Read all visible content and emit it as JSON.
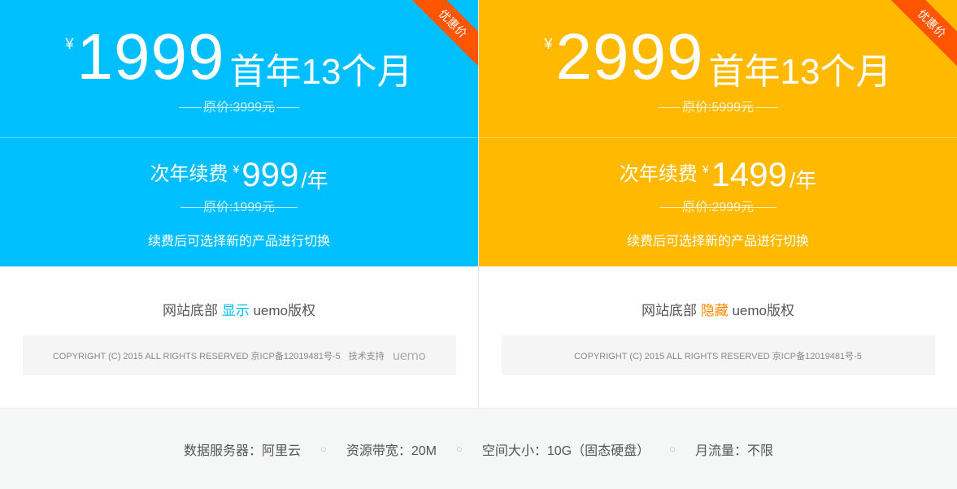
{
  "plans": [
    {
      "ribbon": "优惠价",
      "currency": "¥",
      "price": "1999",
      "period": "首年13个月",
      "original": "原价:3999元",
      "renew_label": "次年续费",
      "renew_currency": "¥",
      "renew_price": "999",
      "renew_unit": "/年",
      "renew_original": "原价:1999元",
      "renew_note": "续费后可选择新的产品进行切换",
      "footer_prefix": "网站底部",
      "footer_state": "显示",
      "footer_suffix": "uemo版权",
      "copyright": "COPYRIGHT (C) 2015  ALL RIGHTS RESERVED 京ICP备12019481号-5",
      "tech_support": "技术支持",
      "logo_text": "uemo"
    },
    {
      "ribbon": "优惠价",
      "currency": "¥",
      "price": "2999",
      "period": "首年13个月",
      "original": "原价:5999元",
      "renew_label": "次年续费",
      "renew_currency": "¥",
      "renew_price": "1499",
      "renew_unit": "/年",
      "renew_original": "原价:2999元",
      "renew_note": "续费后可选择新的产品进行切换",
      "footer_prefix": "网站底部",
      "footer_state": "隐藏",
      "footer_suffix": "uemo版权",
      "copyright": "COPYRIGHT (C) 2015  ALL RIGHTS RESERVED 京ICP备12019481号-5"
    }
  ],
  "specs": [
    "数据服务器：阿里云",
    "资源带宽：20M",
    "空间大小：10G（固态硬盘）",
    "月流量：不限"
  ],
  "separator": "○",
  "colors": {
    "blue": "#00bfff",
    "orange": "#ffba00",
    "ribbon": "#ff5400"
  }
}
